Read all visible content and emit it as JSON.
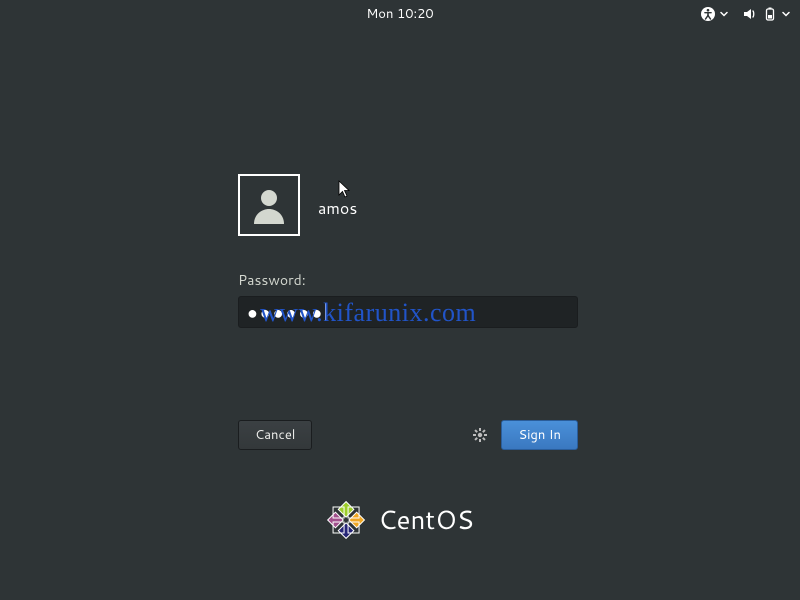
{
  "topbar": {
    "clock": "Mon 10:20"
  },
  "icons": {
    "accessibility": "accessibility-icon",
    "volume": "volume-icon",
    "battery": "battery-icon",
    "chevron_down": "chevron-down-icon",
    "gear": "gear-icon",
    "avatar": "user-avatar-icon",
    "cursor": "cursor-icon"
  },
  "user": {
    "name": "amos"
  },
  "password": {
    "label": "Password:",
    "masked_value": "●●●●●●"
  },
  "buttons": {
    "cancel": "Cancel",
    "signin": "Sign In"
  },
  "brand": {
    "name": "CentOS"
  },
  "watermark": "www.kifarunix.com"
}
